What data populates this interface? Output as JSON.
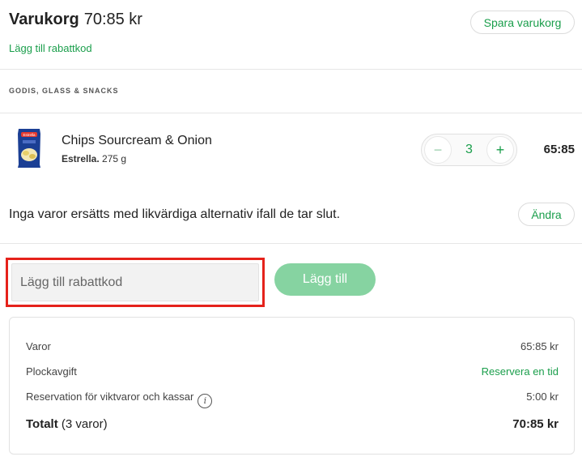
{
  "cart": {
    "title": "Varukorg",
    "total": "70:85 kr",
    "save_label": "Spara varukorg",
    "add_code_link": "Lägg till rabattkod"
  },
  "category": {
    "name": "GODIS, GLASS & SNACKS"
  },
  "product": {
    "name": "Chips Sourcream & Onion",
    "brand": "Estrella.",
    "size": "275 g",
    "quantity": "3",
    "minus": "−",
    "plus": "+",
    "price": "65:85",
    "thumb_brand_text": "Estrella",
    "thumb_color": "#1b3f94"
  },
  "substitution": {
    "text": "Inga varor ersätts med likvärdiga alternativ ifall de tar slut.",
    "change_label": "Ändra"
  },
  "discount": {
    "placeholder": "Lägg till rabattkod",
    "button_label": "Lägg till"
  },
  "summary": {
    "items_label": "Varor",
    "items_value": "65:85 kr",
    "fee_label": "Plockavgift",
    "fee_value": "Reservera en tid",
    "reservation_label": "Reservation för viktvaror och kassar",
    "reservation_value": "5:00 kr",
    "total_label": "Totalt",
    "total_count": "(3 varor)",
    "total_value": "70:85 kr",
    "info_icon": "i"
  },
  "colors": {
    "accent": "#1a9e4b",
    "accent_disabled": "#86d3a1",
    "highlight": "#e5221b"
  }
}
